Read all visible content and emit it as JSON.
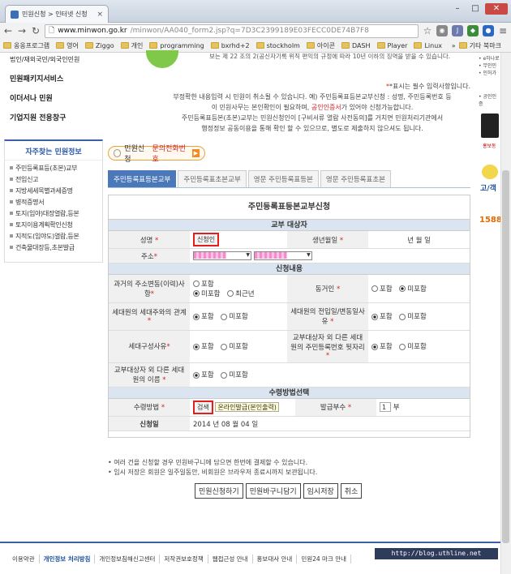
{
  "browser": {
    "tab_title": "민원신청 > 인터넷 신청",
    "url_host": "www.minwon.go.kr",
    "url_path": "/minwon/AA040_form2.jsp?q=7D3C2399189E03FECC0DE74B7F8",
    "bookmarks": [
      "옹옹프로그램",
      "영어",
      "Ziggo",
      "개인",
      "programming",
      "bxrhd+2",
      "stockholm",
      "아이콘",
      "DASH",
      "Player",
      "Linux"
    ],
    "bookmarks_more": "»",
    "bookmarks_other": "기타 북마크"
  },
  "left_menu": {
    "items": [
      "법인/재외국민/외국인민원",
      "민원패키지서비스",
      "이더서나 민원",
      "기업지원 전용창구"
    ]
  },
  "side_box": {
    "title": "자주찾는 민원정보",
    "items": [
      "주민등록표등(초본)교부",
      "전입신고",
      "지방세세목별과세증명",
      "병적증명서",
      "토지(임야)대장열람,등본",
      "토지이용계획확인신청",
      "지적도(임야도)열람,등본",
      "건축물대장등,초본발급"
    ]
  },
  "banner_text": "보는 제 22 조의 2(공신자기록 위직 편익의 규정에 따라 10년 이하의 징역을 받을 수 있습니다.",
  "notice": {
    "line1": "*표시는 필수 입력사항입니다.",
    "line2": "부정확한 내용입력 시 민원이 취소될 수 있습니다. 예) 주민등록표등본교부신청 : 성명, 주민등록번호 등",
    "line3a": "이 민원사무는 본인확인이 필요하며,",
    "line3b": "공인인증서",
    "line3c": "가 있어야 신청가능합니다.",
    "line4": "주민등록표등본(초본)교부는 민원신청인이 [구비서류 열람 사전동의]를 거치면 민원처리기관에서",
    "line5": "행정정보 공동이용을 통해 확인 할 수 있으므로, 별도로 제출하지 않으셔도 됩니다."
  },
  "call_button": {
    "prefix": "민원신청",
    "highlight": "문의전화번호"
  },
  "tabs": [
    "주민등록표등본교부",
    "주민등록표초본교부",
    "영문 주민등록표등본",
    "영문 주민등록표초본"
  ],
  "form": {
    "title": "주민등록표등본교부신청",
    "section_target": "교부 대상자",
    "name_label": "성명",
    "name_btn": "신청인",
    "birth_label": "생년월일",
    "birth_value": "년   월   일",
    "address_label": "주소",
    "section_apply": "신청내용",
    "past_address_label": "과거의 주소변동(이력)사항",
    "past_opts": [
      "포함",
      "미포함",
      "최근년"
    ],
    "cohabit_label": "동거인",
    "cohabit_opts": [
      "포함",
      "미포함"
    ],
    "head_rel_label": "세대원의 세대주와의 관계",
    "head_rel_opts": [
      "포함",
      "미포함"
    ],
    "move_reason_label": "세대원의 전입일/변동일사유",
    "move_reason_opts": [
      "포함",
      "미포함"
    ],
    "compose_label": "세대구성사유",
    "compose_opts": [
      "포함",
      "미포함"
    ],
    "rrn_label": "교부대상자 외 다른 세대원의 주민등록번호 뒷자리",
    "rrn_opts": [
      "포함",
      "미포함"
    ],
    "other_names_label": "교부대상자 외 다른 세대원의 이름",
    "other_names_opts": [
      "포함",
      "미포함"
    ],
    "section_receive": "수령방법선택",
    "receive_label": "수령방법",
    "receive_btn": "검색",
    "receive_value": "온라인발급(본인출력)",
    "copies_label": "발급부수",
    "copies_value": "1",
    "copies_unit": "부",
    "date_label": "신청일",
    "date_value": "2014  년 08  월 04  일"
  },
  "bullets": [
    "• 여러 건을 신청할 경우 민원바구니에 담으면 한번에 결제할 수 있습니다.",
    "• 임시 저장은 회원은 일주일동안, 비회원은 브라우저 종료시까지 보관됩니다."
  ],
  "actions": [
    "민원신청하기",
    "민원바구니담기",
    "임시저장",
    "취소"
  ],
  "footer": [
    "이용약관",
    "개인정보 처리방침",
    "개인정보침해신고센터",
    "저작권보호정책",
    "웹접근성 안내",
    "홍보대사 안내",
    "민원24 마크 안내"
  ],
  "watermark": "http://blog.uthline.net"
}
